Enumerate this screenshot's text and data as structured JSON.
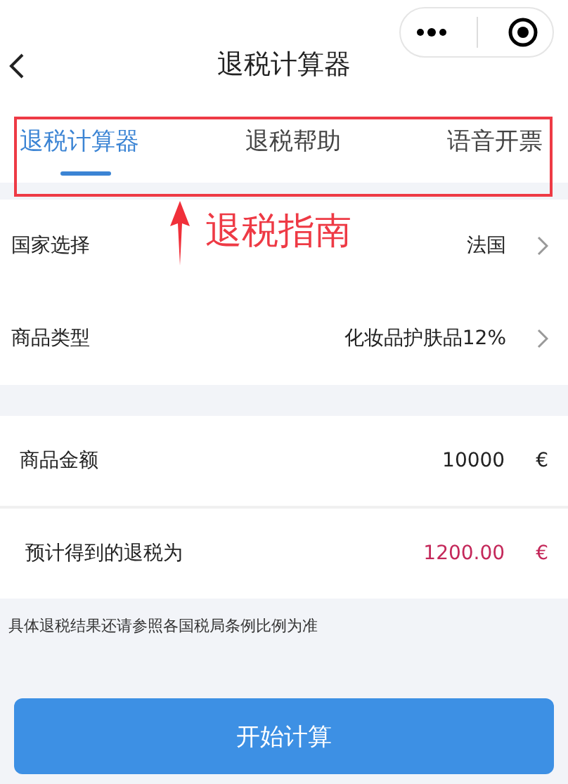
{
  "nav": {
    "title": "退税计算器"
  },
  "tabs": [
    {
      "label": "退税计算器",
      "selected": true
    },
    {
      "label": "退税帮助",
      "selected": false
    },
    {
      "label": "语音开票",
      "selected": false
    }
  ],
  "annotation": {
    "text": "退税指南"
  },
  "selects": [
    {
      "label": "国家选择",
      "value": "法国"
    },
    {
      "label": "商品类型",
      "value": "化妆品护肤品12%"
    }
  ],
  "amounts": [
    {
      "kind": "input",
      "label": "商品金额",
      "value": "10000",
      "unit": "€"
    },
    {
      "kind": "result",
      "label": "预计得到的退税为",
      "value": "1200.00",
      "unit": "€"
    }
  ],
  "note": "具体退税结果还请参照各国税局条例比例为准",
  "button": "开始计算"
}
